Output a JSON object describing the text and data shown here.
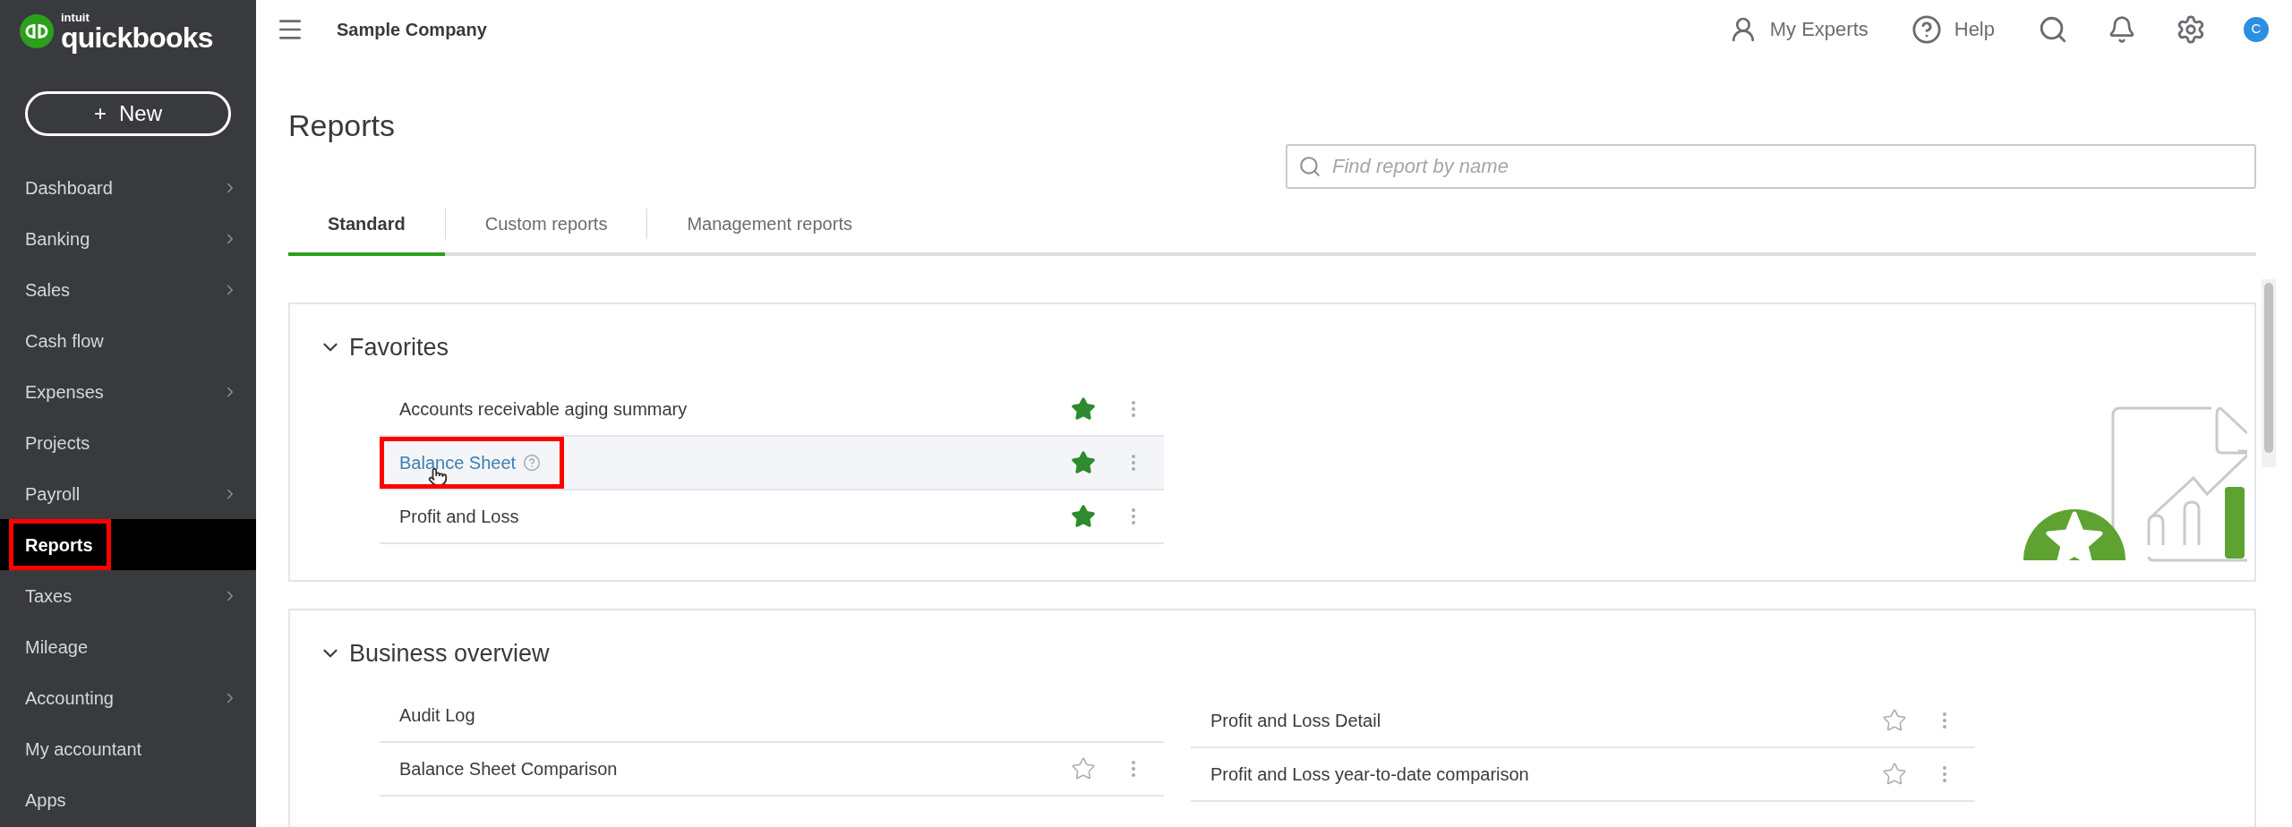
{
  "brand": {
    "company": "intuit",
    "product": "quickbooks"
  },
  "new_button": {
    "icon": "+",
    "label": "New"
  },
  "sidebar": {
    "items": [
      {
        "label": "Dashboard",
        "has_submenu": true,
        "selected": false,
        "highlighted": false
      },
      {
        "label": "Banking",
        "has_submenu": true,
        "selected": false,
        "highlighted": false
      },
      {
        "label": "Sales",
        "has_submenu": true,
        "selected": false,
        "highlighted": false
      },
      {
        "label": "Cash flow",
        "has_submenu": false,
        "selected": false,
        "highlighted": false
      },
      {
        "label": "Expenses",
        "has_submenu": true,
        "selected": false,
        "highlighted": false
      },
      {
        "label": "Projects",
        "has_submenu": false,
        "selected": false,
        "highlighted": false
      },
      {
        "label": "Payroll",
        "has_submenu": true,
        "selected": false,
        "highlighted": false
      },
      {
        "label": "Reports",
        "has_submenu": false,
        "selected": true,
        "highlighted": true
      },
      {
        "label": "Taxes",
        "has_submenu": true,
        "selected": false,
        "highlighted": false
      },
      {
        "label": "Mileage",
        "has_submenu": false,
        "selected": false,
        "highlighted": false
      },
      {
        "label": "Accounting",
        "has_submenu": true,
        "selected": false,
        "highlighted": false
      },
      {
        "label": "My accountant",
        "has_submenu": false,
        "selected": false,
        "highlighted": false
      },
      {
        "label": "Apps",
        "has_submenu": false,
        "selected": false,
        "highlighted": false
      }
    ]
  },
  "top_bar": {
    "company": "Sample Company",
    "experts": "My Experts",
    "help": "Help",
    "avatar": "C"
  },
  "page": {
    "title": "Reports",
    "search": {
      "placeholder": "Find report by name"
    }
  },
  "tabs": [
    {
      "label": "Standard",
      "selected": true
    },
    {
      "label": "Custom reports",
      "selected": false
    },
    {
      "label": "Management reports",
      "selected": false
    }
  ],
  "sections": [
    {
      "title": "Favorites",
      "expanded": true,
      "illustration": true,
      "columns": [
        [
          {
            "label": "Accounts receivable aging summary",
            "kind": "report",
            "starred": true,
            "hovered": false,
            "has_help": false,
            "highlighted": false
          },
          {
            "label": "Balance Sheet",
            "kind": "report",
            "starred": true,
            "hovered": true,
            "has_help": true,
            "highlighted": true
          },
          {
            "label": "Profit and Loss",
            "kind": "report",
            "starred": true,
            "hovered": false,
            "has_help": false,
            "highlighted": false
          }
        ]
      ]
    },
    {
      "title": "Business overview",
      "expanded": true,
      "illustration": false,
      "columns": [
        [
          {
            "label": "Audit Log",
            "kind": "plain",
            "hovered": false,
            "has_help": false,
            "highlighted": false
          },
          {
            "label": "Balance Sheet Comparison",
            "kind": "report",
            "starred": false,
            "hovered": false,
            "has_help": false,
            "highlighted": false
          }
        ],
        [
          {
            "label": "Profit and Loss Detail",
            "kind": "report",
            "starred": false,
            "hovered": false,
            "has_help": false,
            "highlighted": false
          },
          {
            "label": "Profit and Loss year-to-date comparison",
            "kind": "report",
            "starred": false,
            "hovered": false,
            "has_help": false,
            "highlighted": false
          }
        ]
      ]
    }
  ]
}
